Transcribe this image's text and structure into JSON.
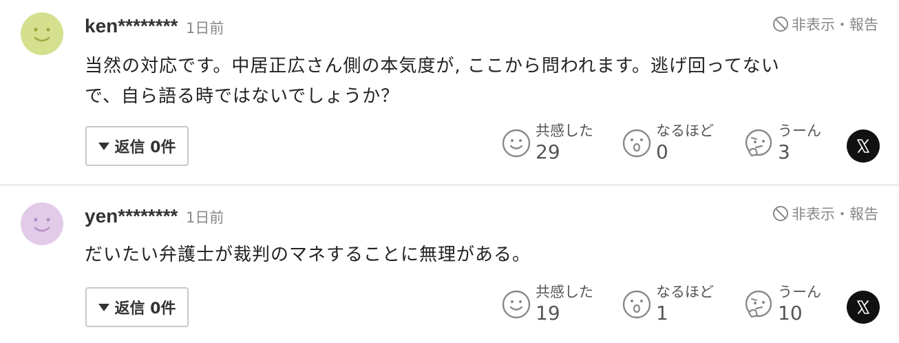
{
  "comments": [
    {
      "username": "ken********",
      "time": "1日前",
      "hide_report": "非表示・報告",
      "body_line1": "当然の対応です。中居正広さん側の本気度が, ここから問われます。逃げ回ってない",
      "body_line2": "で、自ら語る時ではないでしょうか？",
      "reply_label": "返信 0件",
      "reactions": [
        {
          "label": "共感した",
          "count": "29",
          "icon": "smile-icon"
        },
        {
          "label": "なるほど",
          "count": "0",
          "icon": "surprised-icon"
        },
        {
          "label": "うーん",
          "count": "3",
          "icon": "thinking-icon"
        }
      ],
      "share_icon": "x-logo-icon",
      "avatar_color": "#d4e08e"
    },
    {
      "username": "yen********",
      "time": "1日前",
      "hide_report": "非表示・報告",
      "body_line1": "だいたい弁護士が裁判のマネすることに無理がある。",
      "body_line2": "",
      "reply_label": "返信 0件",
      "reactions": [
        {
          "label": "共感した",
          "count": "19",
          "icon": "smile-icon"
        },
        {
          "label": "なるほど",
          "count": "1",
          "icon": "surprised-icon"
        },
        {
          "label": "うーん",
          "count": "10",
          "icon": "thinking-icon"
        }
      ],
      "share_icon": "x-logo-icon",
      "avatar_color": "#e2cbe8"
    }
  ]
}
